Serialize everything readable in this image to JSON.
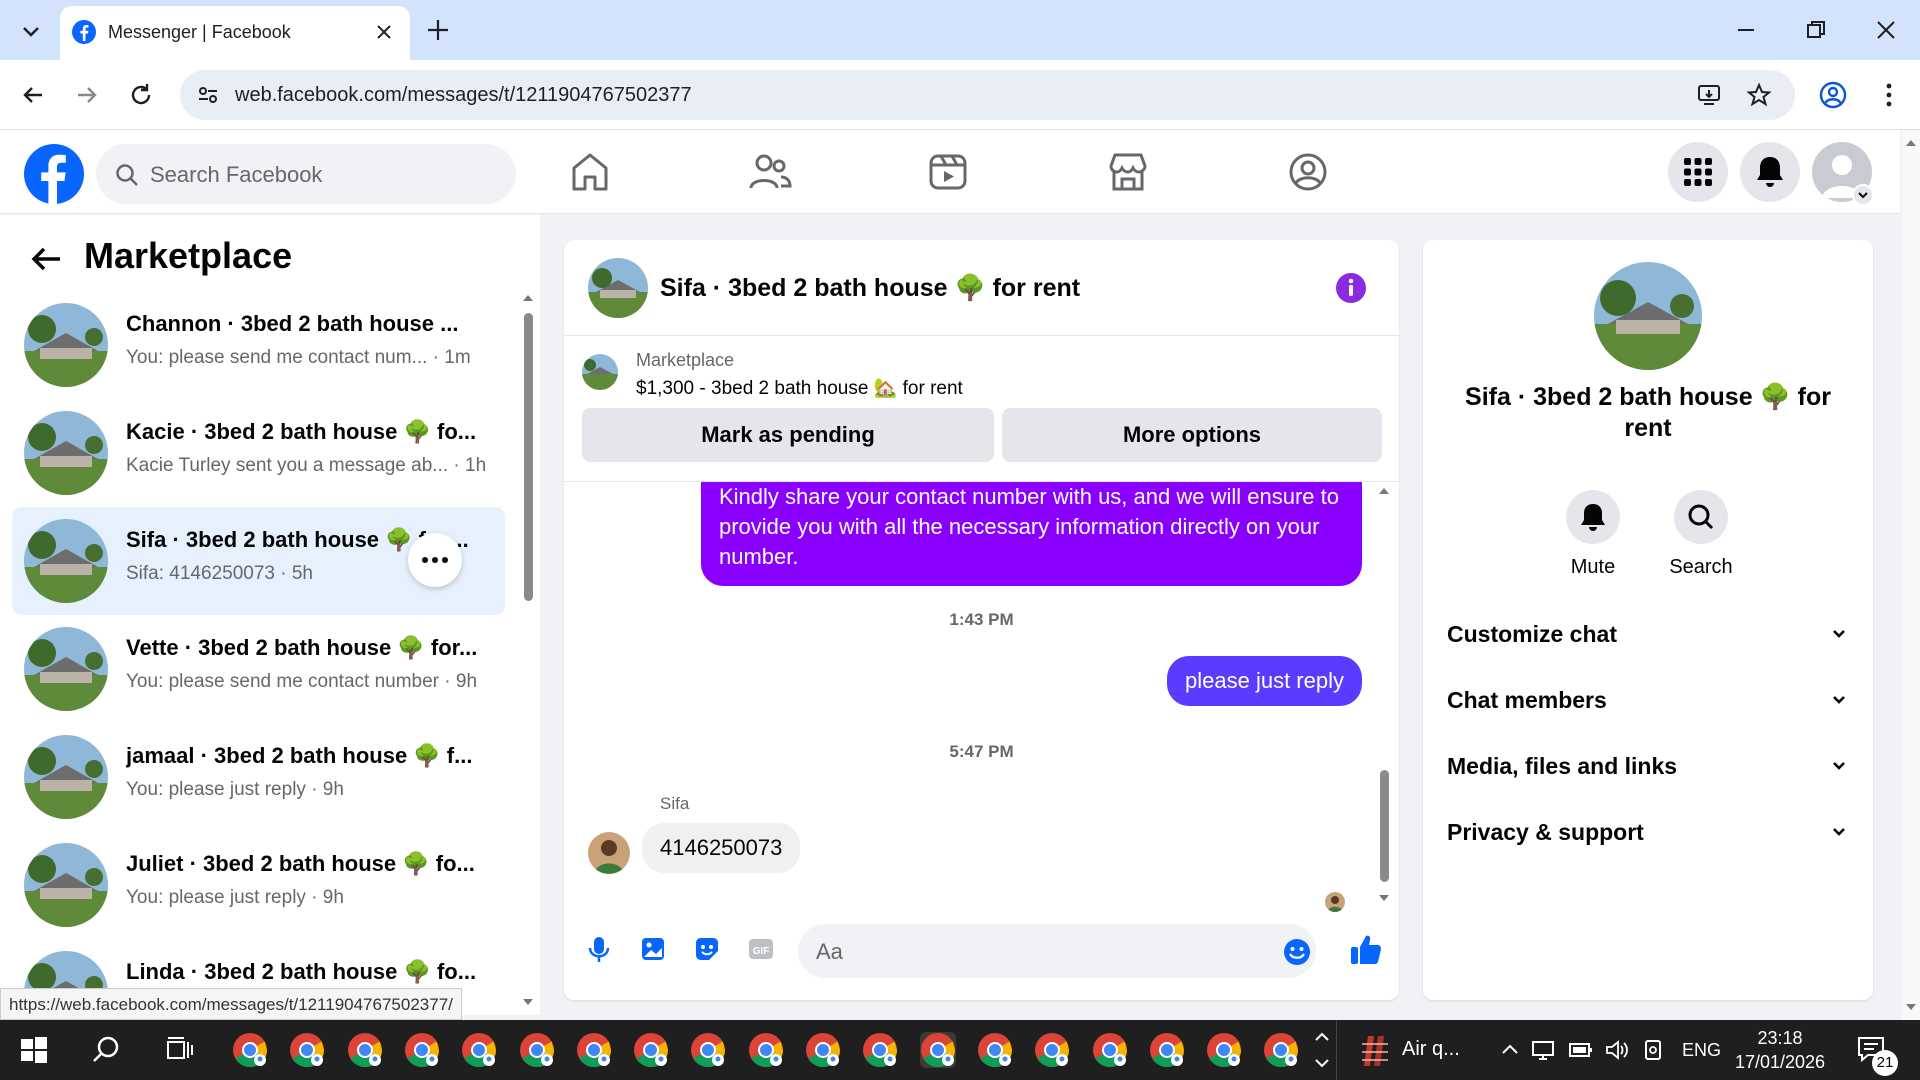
{
  "browser": {
    "tab_title": "Messenger | Facebook",
    "url": "web.facebook.com/messages/t/1211904767502377",
    "status_url": "https://web.facebook.com/messages/t/1211904767502377/"
  },
  "fb": {
    "search_placeholder": "Search Facebook"
  },
  "sidebar": {
    "title": "Marketplace",
    "conversations": [
      {
        "name": "Channon · 3bed 2 bath house ...",
        "preview": "You: please send me contact num... · 1m"
      },
      {
        "name": "Kacie · 3bed 2 bath house 🌳 fo...",
        "preview": "Kacie Turley sent you a message ab... · 1h"
      },
      {
        "name": "Sifa · 3bed 2 bath house 🌳 f... ...",
        "preview": "Sifa: 4146250073 · 5h"
      },
      {
        "name": "Vette · 3bed 2 bath house 🌳 for...",
        "preview": "You: please send me contact number · 9h"
      },
      {
        "name": "jamaal · 3bed 2 bath house 🌳 f...",
        "preview": "You: please just reply · 9h"
      },
      {
        "name": "Juliet · 3bed 2 bath house 🌳 fo...",
        "preview": "You: please just reply · 9h"
      },
      {
        "name": "Linda · 3bed 2 bath house 🌳 fo...",
        "preview": ""
      }
    ]
  },
  "chat": {
    "title": "Sifa · 3bed 2 bath house 🌳 for rent",
    "listing_label": "Marketplace",
    "listing_text": "$1,300 - 3bed 2 bath house 🏡 for rent",
    "mark_pending": "Mark as pending",
    "more_options": "More options",
    "messages": {
      "out1": "Kindly share your contact number with us, and we will ensure to provide you with all the necessary information directly on your number.",
      "ts1": "1:43 PM",
      "out2": "please just reply",
      "ts2": "5:47 PM",
      "sender": "Sifa",
      "in1": "4146250073"
    },
    "composer_placeholder": "Aa"
  },
  "info": {
    "name": "Sifa · 3bed 2 bath house 🌳 for rent",
    "mute": "Mute",
    "search": "Search",
    "rows": [
      "Customize chat",
      "Chat members",
      "Media, files and links",
      "Privacy & support"
    ]
  },
  "taskbar": {
    "weather": "Air q...",
    "lang": "ENG",
    "time": "23:18",
    "date": "17/01/2026",
    "notif_count": "21"
  },
  "colors": {
    "fb_blue": "#0866ff",
    "bubble_purple": "#8a00ff",
    "bubble_blue": "#5b3bff",
    "info_purple": "#8a2be2"
  }
}
